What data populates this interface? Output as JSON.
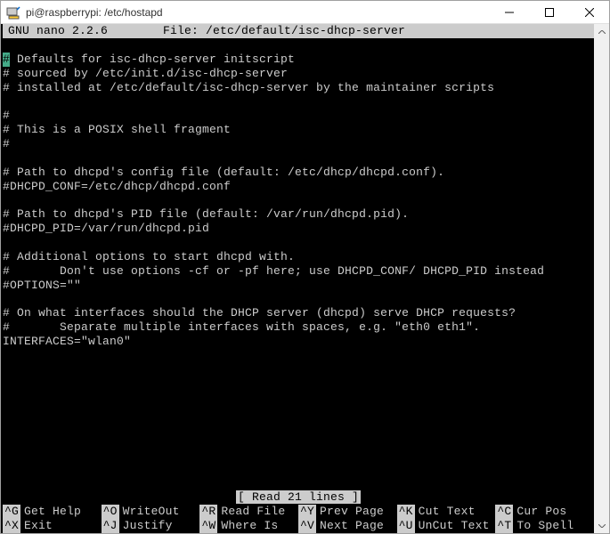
{
  "window": {
    "title": "pi@raspberrypi: /etc/hostapd"
  },
  "nano": {
    "version": "GNU nano 2.2.6",
    "file_label": "File: /etc/default/isc-dhcp-server",
    "status": "[ Read 21 lines ]",
    "content_lines": [
      "# Defaults for isc-dhcp-server initscript",
      "# sourced by /etc/init.d/isc-dhcp-server",
      "# installed at /etc/default/isc-dhcp-server by the maintainer scripts",
      "",
      "#",
      "# This is a POSIX shell fragment",
      "#",
      "",
      "# Path to dhcpd's config file (default: /etc/dhcp/dhcpd.conf).",
      "#DHCPD_CONF=/etc/dhcp/dhcpd.conf",
      "",
      "# Path to dhcpd's PID file (default: /var/run/dhcpd.pid).",
      "#DHCPD_PID=/var/run/dhcpd.pid",
      "",
      "# Additional options to start dhcpd with.",
      "#       Don't use options -cf or -pf here; use DHCPD_CONF/ DHCPD_PID instead",
      "#OPTIONS=\"\"",
      "",
      "# On what interfaces should the DHCP server (dhcpd) serve DHCP requests?",
      "#       Separate multiple interfaces with spaces, e.g. \"eth0 eth1\".",
      "INTERFACES=\"wlan0\""
    ],
    "shortcuts": [
      {
        "key": "^G",
        "label": "Get Help"
      },
      {
        "key": "^O",
        "label": "WriteOut"
      },
      {
        "key": "^R",
        "label": "Read File"
      },
      {
        "key": "^Y",
        "label": "Prev Page"
      },
      {
        "key": "^K",
        "label": "Cut Text"
      },
      {
        "key": "^C",
        "label": "Cur Pos"
      },
      {
        "key": "^X",
        "label": "Exit"
      },
      {
        "key": "^J",
        "label": "Justify"
      },
      {
        "key": "^W",
        "label": "Where Is"
      },
      {
        "key": "^V",
        "label": "Next Page"
      },
      {
        "key": "^U",
        "label": "UnCut Text"
      },
      {
        "key": "^T",
        "label": "To Spell"
      }
    ]
  }
}
